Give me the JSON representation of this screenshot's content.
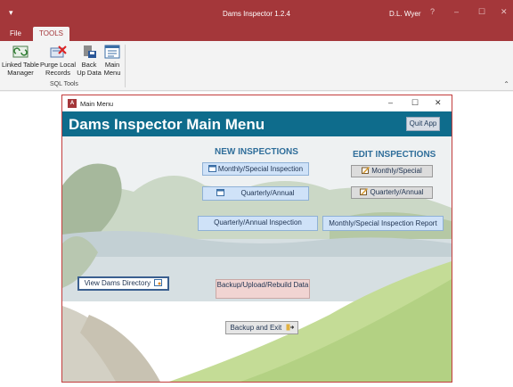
{
  "app": {
    "title": "Dams Inspector 1.2.4",
    "user": "D.L. Wyer",
    "quick_access": "▾",
    "help_symbol": "?",
    "min_symbol": "–",
    "max_symbol": "☐",
    "close_symbol": "✕"
  },
  "ribbon": {
    "tabs": [
      "File",
      "TOOLS"
    ],
    "buttons": [
      {
        "label": "Linked Table Manager",
        "icon": "linked-table-icon"
      },
      {
        "label": "Purge Local Records",
        "icon": "purge-icon"
      },
      {
        "label": "Back Up Data",
        "icon": "backup-icon"
      },
      {
        "label": "Main Menu",
        "icon": "main-menu-icon"
      }
    ],
    "group_label": "SQL Tools",
    "collapse_symbol": "⌃"
  },
  "form": {
    "window_title": "Main Menu",
    "icon_text": "A",
    "min_symbol": "–",
    "max_symbol": "☐",
    "close_symbol": "✕",
    "heading": "Dams Inspector Main Menu",
    "quit_label": "Quit App",
    "new_inspections": {
      "title": "NEW INSPECTIONS",
      "monthly": "Monthly/Special Inspection",
      "quarterly": "Quarterly/Annual"
    },
    "edit_inspections": {
      "title": "EDIT INSPECTIONS",
      "monthly": "Monthly/Special",
      "quarterly": "Quarterly/Annual"
    },
    "quarterly_report": "Quarterly/Annual Inspection",
    "monthly_report": "Monthly/Special Inspection Report",
    "view_directory": "View Dams Directory",
    "backup_rebuild": "Backup/Upload/Rebuild Data",
    "backup_exit": "Backup and Exit"
  },
  "colors": {
    "accent": "#a4373a",
    "header_teal": "#0e6c8c",
    "section_title": "#2f6e9a"
  }
}
